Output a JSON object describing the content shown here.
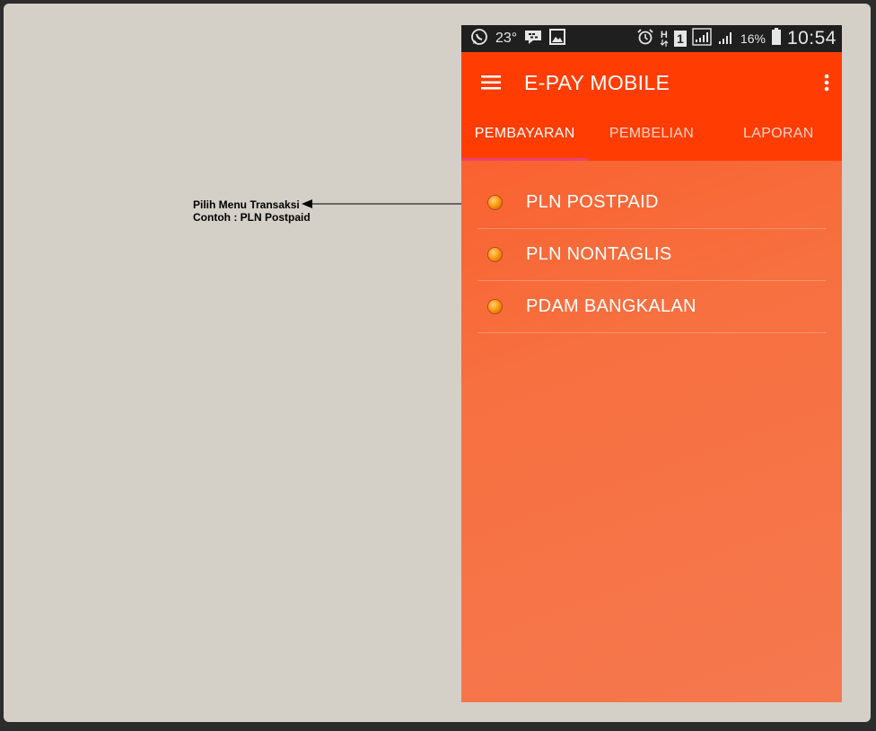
{
  "annotation": {
    "line1": "Pilih Menu Transaksi",
    "line2": "Contoh : PLN Postpaid"
  },
  "status_bar": {
    "temperature": "23°",
    "battery_percent": "16%",
    "time": "10:54",
    "network_label": "H",
    "sim_label": "1",
    "icons": [
      "whatsapp-icon",
      "bbm-icon",
      "gallery-icon",
      "alarm-icon",
      "network-h-icon",
      "sim-1-icon",
      "signal-icon",
      "signal-icon",
      "battery-icon"
    ]
  },
  "app": {
    "title": "E-PAY MOBILE",
    "colors": {
      "primary": "#ff3d03",
      "tab_indicator": "#e8426e",
      "bullet": "#ff9a10"
    }
  },
  "tabs": [
    {
      "label": "PEMBAYARAN",
      "active": true
    },
    {
      "label": "PEMBELIAN",
      "active": false
    },
    {
      "label": "LAPORAN",
      "active": false
    }
  ],
  "menu": {
    "items": [
      {
        "label": "PLN POSTPAID"
      },
      {
        "label": "PLN NONTAGLIS"
      },
      {
        "label": "PDAM BANGKALAN"
      }
    ]
  }
}
